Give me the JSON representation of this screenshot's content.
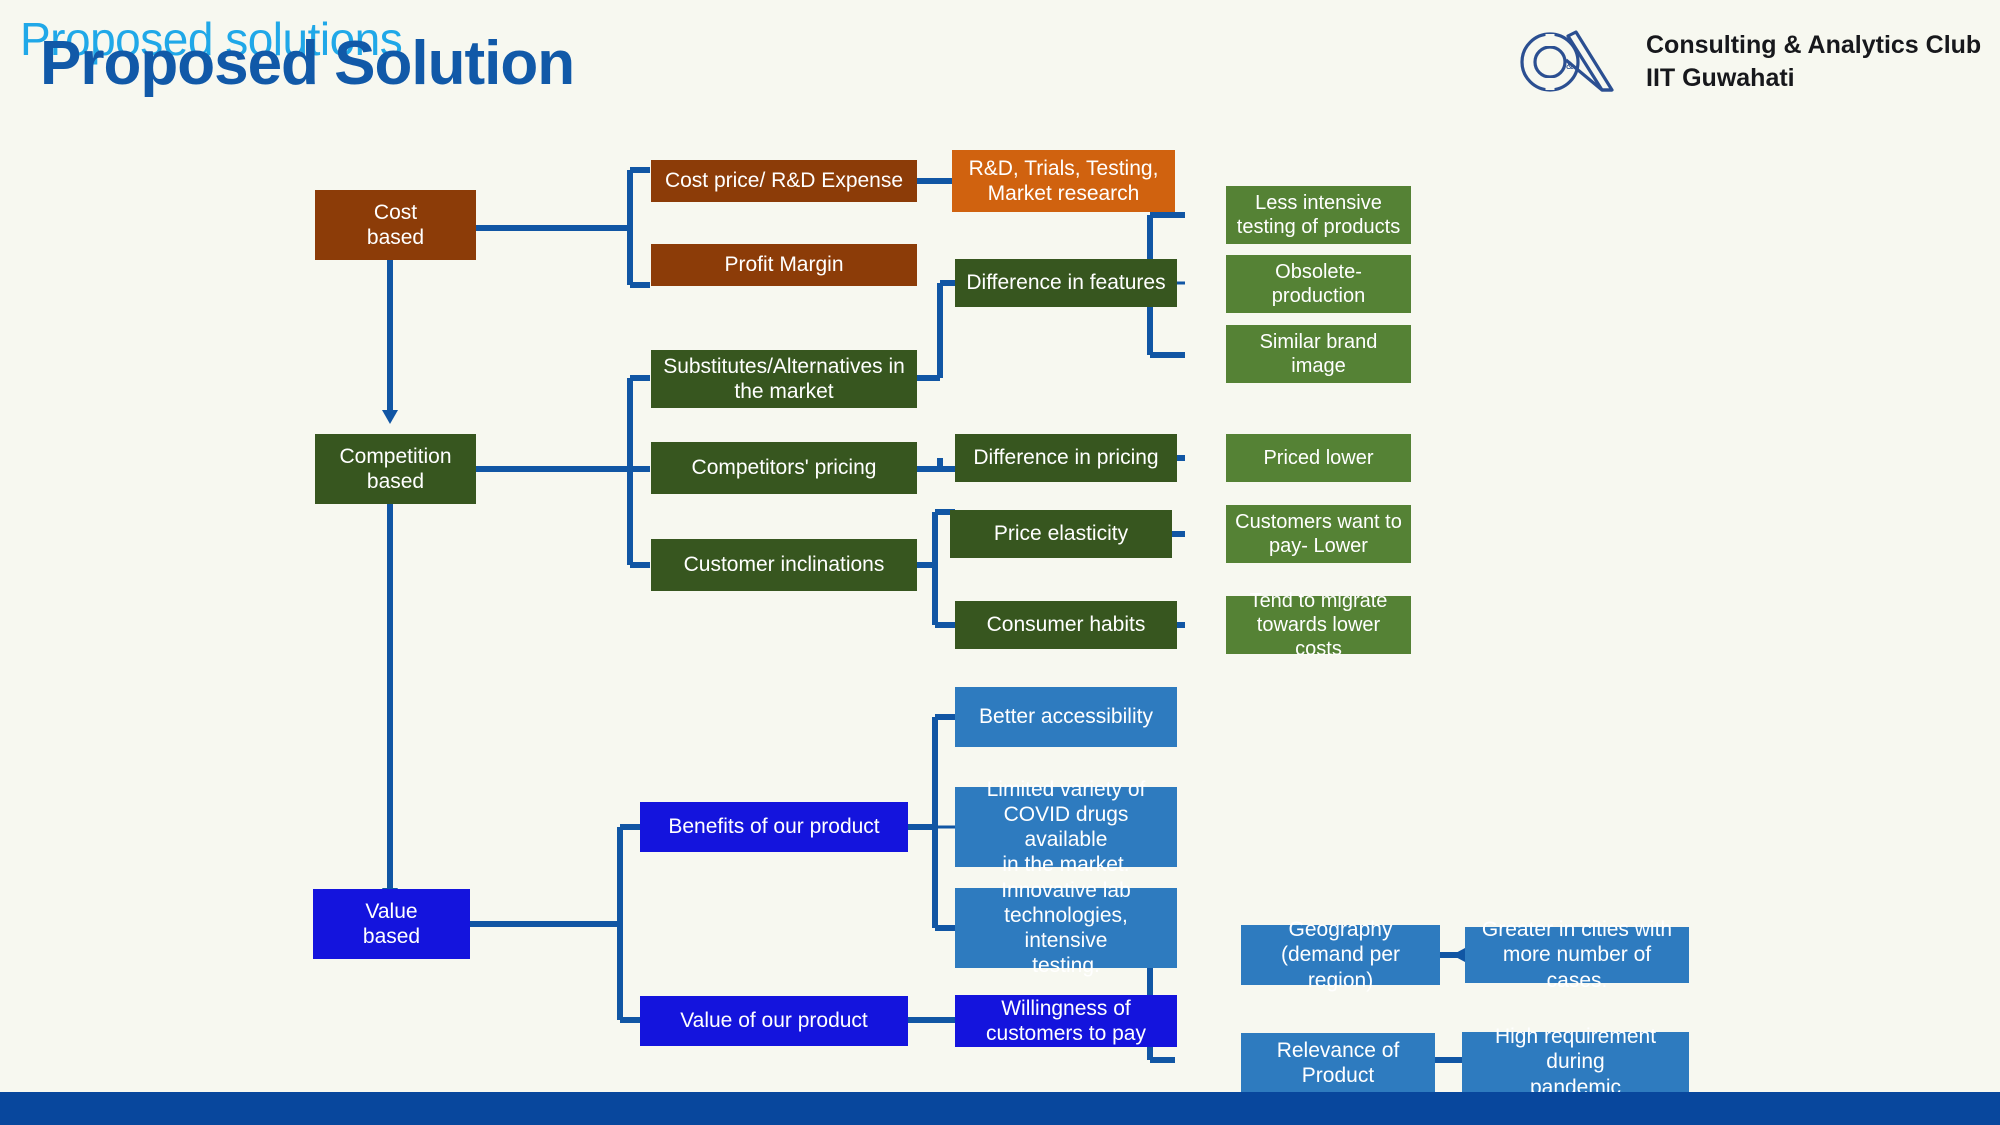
{
  "slide": {
    "background_color": "#f7f8f0",
    "bottom_bar_color": "#08479d"
  },
  "title": {
    "ghost_text": "Proposed solutions",
    "ghost_color": "#20a8e8",
    "main_text": "Proposed Solution",
    "main_color": "#1159a8"
  },
  "logo": {
    "mark_name": "ca-monogram-logo",
    "mark_color": "#2b4f91",
    "line1": "Consulting & Analytics Club",
    "line2": "IIT Guwahati"
  },
  "palette": {
    "brown": "#8c3c08",
    "orange": "#d0620f",
    "dark_green": "#37561f",
    "mid_green": "#558235",
    "vivid_blue": "#1414dd",
    "steel_blue": "#2e7bbf",
    "connector": "#1156a4"
  },
  "diagram": {
    "type": "flowchart",
    "branches": [
      {
        "id": "cost-based",
        "root": "Cost\nbased",
        "color": "brown",
        "level2": [
          {
            "label": "Cost price/ R&D Expense",
            "color": "brown"
          },
          {
            "label": "Profit Margin",
            "color": "brown"
          }
        ],
        "level3": [
          {
            "label": "R&D, Trials, Testing,\nMarket research",
            "color": "orange"
          }
        ]
      },
      {
        "id": "competition-based",
        "root": "Competition\nbased",
        "color": "dark_green",
        "level2": [
          {
            "label": "Substitutes/Alternatives in\nthe market",
            "color": "dark_green"
          },
          {
            "label": "Competitors' pricing",
            "color": "dark_green"
          },
          {
            "label": "Customer inclinations",
            "color": "dark_green"
          }
        ],
        "level3": [
          {
            "label": "Difference in features",
            "color": "dark_green"
          },
          {
            "label": "Difference in pricing",
            "color": "dark_green"
          },
          {
            "label": "Price elasticity",
            "color": "dark_green"
          },
          {
            "label": "Consumer habits",
            "color": "dark_green"
          }
        ],
        "level4": [
          {
            "label": "Less intensive\ntesting of products",
            "color": "mid_green"
          },
          {
            "label": "Obsolete-\nproduction",
            "color": "mid_green"
          },
          {
            "label": "Similar brand\nimage",
            "color": "mid_green"
          },
          {
            "label": "Priced lower",
            "color": "mid_green"
          },
          {
            "label": "Customers want to\npay- Lower",
            "color": "mid_green"
          },
          {
            "label": "Tend to migrate\ntowards lower costs",
            "color": "mid_green"
          }
        ]
      },
      {
        "id": "value-based",
        "root": "Value\nbased",
        "color": "vivid_blue",
        "level2": [
          {
            "label": "Benefits of our product",
            "color": "vivid_blue"
          },
          {
            "label": "Value of our product",
            "color": "vivid_blue"
          }
        ],
        "level3": [
          {
            "label": "Better accessibility",
            "color": "steel_blue"
          },
          {
            "label": "Limited variety of\nCOVID drugs available\nin the market.",
            "color": "steel_blue"
          },
          {
            "label": "Innovative lab\ntechnologies, intensive\ntesting.",
            "color": "steel_blue"
          },
          {
            "label": "Willingness of\ncustomers to pay",
            "color": "vivid_blue"
          }
        ],
        "level4": [
          {
            "label": "Geography\n(demand per region)",
            "color": "steel_blue"
          },
          {
            "label": "Relevance of\nProduct",
            "color": "steel_blue"
          }
        ],
        "level5": [
          {
            "label": "Greater in cities with\nmore number of cases.",
            "color": "steel_blue"
          },
          {
            "label": "High requirement during\npandemic",
            "color": "steel_blue"
          }
        ]
      }
    ],
    "nodes": {
      "cost_based": "Cost\nbased",
      "cost_price_rd": "Cost price/ R&D Expense",
      "profit_margin": "Profit Margin",
      "rd_trials": "R&D, Trials, Testing,\nMarket research",
      "competition_based": "Competition\nbased",
      "substitutes": "Substitutes/Alternatives in\nthe market",
      "competitors_pricing": "Competitors' pricing",
      "customer_inclinations": "Customer inclinations",
      "difference_features": "Difference in features",
      "difference_pricing": "Difference in pricing",
      "price_elasticity": "Price elasticity",
      "consumer_habits": "Consumer habits",
      "less_intensive": "Less intensive\ntesting of products",
      "obsolete_production": "Obsolete-\nproduction",
      "similar_brand": "Similar brand\nimage",
      "priced_lower": "Priced lower",
      "customers_want": "Customers want to\npay- Lower",
      "tend_migrate": "Tend to migrate\ntowards lower costs",
      "value_based": "Value\nbased",
      "benefits_product": "Benefits of our product",
      "value_of_product": "Value of our product",
      "better_accessibility": "Better accessibility",
      "limited_variety": "Limited variety of\nCOVID drugs available\nin the market.",
      "innovative_lab": "Innovative lab\ntechnologies, intensive\ntesting.",
      "willingness_pay": "Willingness of\ncustomers to pay",
      "geography": "Geography\n(demand per region)",
      "relevance_product": "Relevance of\nProduct",
      "greater_cities": "Greater in cities with\nmore number of cases.",
      "high_requirement": "High requirement during\npandemic"
    }
  }
}
